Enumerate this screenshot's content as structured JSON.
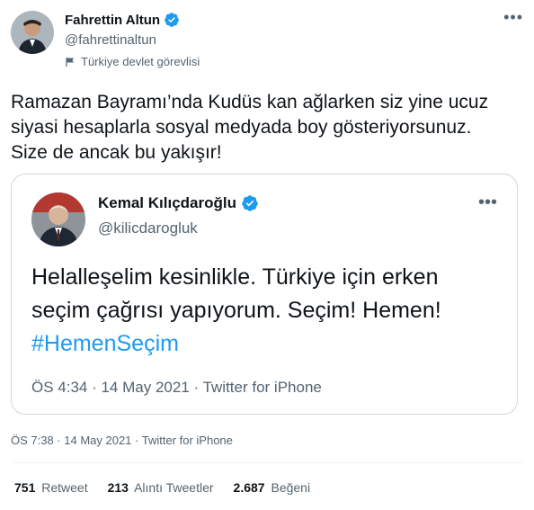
{
  "author": {
    "name": "Fahrettin Altun",
    "handle": "@fahrettinaltun",
    "label": "Türkiye devlet görevlisi",
    "verified_color": "#1d9bf0"
  },
  "tweet": {
    "lines": [
      "Ramazan Bayramı’nda Kudüs kan ağlarken siz yine ucuz",
      "siyasi hesaplarla sosyal medyada boy gösteriyorsunuz.",
      "Size de ancak bu yakışır!"
    ]
  },
  "quoted": {
    "name": "Kemal Kılıçdaroğlu",
    "handle": "@kilicdarogluk",
    "lines": [
      "Helalleşelim kesinlikle. Türkiye için erken",
      "seçim çağrısı yapıyorum. Seçim! Hemen!"
    ],
    "hashtag": "#HemenSeçim",
    "meta": "ÖS 4:34 · 14 May 2021 · Twitter for iPhone"
  },
  "meta": "ÖS 7:38 · 14 May 2021 · Twitter for iPhone",
  "stats": {
    "retweets_count": "751",
    "retweets_label": "Retweet",
    "quotes_count": "213",
    "quotes_label": "Alıntı Tweetler",
    "likes_count": "2.687",
    "likes_label": "Beğeni"
  },
  "colors": {
    "accent": "#1d9bf0",
    "secondary_text": "#536471",
    "border": "#cfd9de"
  }
}
